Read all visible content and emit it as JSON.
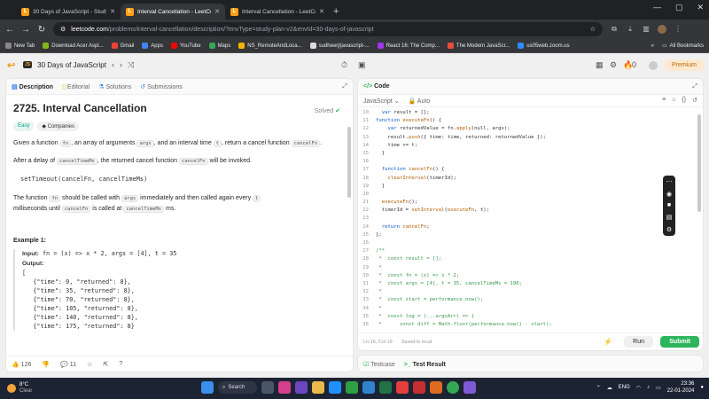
{
  "browser": {
    "tabs": [
      {
        "title": "30 Days of JavaScript - Study P",
        "color": "#ffa116",
        "glyph": "L"
      },
      {
        "title": "Interval Cancellation - LeetCod",
        "color": "#ffa116",
        "glyph": "L"
      },
      {
        "title": "Interval Cancellation - LeetCod",
        "color": "#ffa116",
        "glyph": "L"
      }
    ],
    "new_tab": "+",
    "url_host": "leetcode.com",
    "url_path": "/problems/interval-cancellation/description/?envType=study-plan-v2&envId=30-days-of-javascript",
    "bookmarks": [
      {
        "label": "New Tab",
        "color": "#888"
      },
      {
        "label": "Download Acer Aspi...",
        "color": "#83b81a"
      },
      {
        "label": "Gmail",
        "color": "#ea4335"
      },
      {
        "label": "Apps",
        "color": "#4285f4"
      },
      {
        "label": "YouTube",
        "color": "#ff0000"
      },
      {
        "label": "Maps",
        "color": "#34a853"
      },
      {
        "label": "NS_RemoteAndLoca...",
        "color": "#f4b400"
      },
      {
        "label": "sudheerj/javascript-...",
        "color": "#ddd"
      },
      {
        "label": "React 16: The Comp...",
        "color": "#a435f0"
      },
      {
        "label": "The Modern JavaScr...",
        "color": "#e94e3c"
      },
      {
        "label": "us05web.zoom.us",
        "color": "#2d8cff"
      }
    ],
    "all_bookmarks": "All Bookmarks"
  },
  "leetcode": {
    "badge": "JS",
    "study_title": "30 Days of JavaScript",
    "streak": "0",
    "premium": "Premium"
  },
  "left": {
    "tabs": {
      "description": "Description",
      "editorial": "Editorial",
      "solutions": "Solutions",
      "submissions": "Submissions"
    },
    "title": "2725. Interval Cancellation",
    "solved": "Solved",
    "difficulty": "Easy",
    "companies": "Companies",
    "p1_a": "Given a function ",
    "p1_fn": "fn",
    "p1_b": ", an array of arguments ",
    "p1_args": "args",
    "p1_c": ", and an interval time ",
    "p1_t": "t",
    "p1_d": ", return a cancel function ",
    "p1_cancel": "cancelFn",
    "p1_e": ".",
    "p2_a": "After a delay of ",
    "p2_ms": "cancelTimeMs",
    "p2_b": ", the returned cancel function ",
    "p2_cancel": "cancelFn",
    "p2_c": " will be invoked.",
    "code_example": "setTimeout(cancelFn, cancelTimeMs)",
    "p3_a": "The function ",
    "p3_fn": "fn",
    "p3_b": " should be called with ",
    "p3_args": "args",
    "p3_c": " immediately and then called again every ",
    "p3_t": "t",
    "p3_d": "milliseconds until ",
    "p3_cancel": "cancelFn",
    "p3_e": " is called at ",
    "p3_ms": "cancelTimeMs",
    "p3_f": " ms.",
    "example_title": "Example 1:",
    "input_label": "Input:",
    "input_value": "fn = (x) => x * 2, args = [4], t = 35",
    "output_label": "Output:",
    "output_lines": [
      "[",
      "   {\"time\": 0, \"returned\": 8},",
      "   {\"time\": 35, \"returned\": 8},",
      "   {\"time\": 70, \"returned\": 8},",
      "   {\"time\": 105, \"returned\": 8},",
      "   {\"time\": 140, \"returned\": 8},",
      "   {\"time\": 175, \"returned\": 8}"
    ],
    "likes": "126",
    "comments": "11"
  },
  "right": {
    "code_tab": "Code",
    "language": "JavaScript",
    "auto": "Auto",
    "code_lines": [
      {
        "n": "10",
        "t": "  var result = [];"
      },
      {
        "n": "11",
        "t": "function executeFn() {"
      },
      {
        "n": "12",
        "t": "    var returnedValue = fn.apply(null, args);"
      },
      {
        "n": "13",
        "t": "    result.push({ time: time, returned: returnedValue });"
      },
      {
        "n": "14",
        "t": "    time += t;"
      },
      {
        "n": "15",
        "t": "  }"
      },
      {
        "n": "16",
        "t": ""
      },
      {
        "n": "17",
        "t": "  function cancelFn() {"
      },
      {
        "n": "18",
        "t": "    clearInterval(timerId);"
      },
      {
        "n": "19",
        "t": "  }"
      },
      {
        "n": "20",
        "t": ""
      },
      {
        "n": "21",
        "t": "  executeFn();"
      },
      {
        "n": "22",
        "t": "  timerId = setInterval(executeFn, t);"
      },
      {
        "n": "23",
        "t": ""
      },
      {
        "n": "24",
        "t": "  return cancelFn;"
      },
      {
        "n": "25",
        "t": "};"
      },
      {
        "n": "26",
        "t": ""
      },
      {
        "n": "27",
        "t": "/**"
      },
      {
        "n": "28",
        "t": " *  const result = [];"
      },
      {
        "n": "29",
        "t": " *"
      },
      {
        "n": "30",
        "t": " *  const fn = (x) => x * 2;"
      },
      {
        "n": "31",
        "t": " *  const args = [4], t = 35, cancelTimeMs = 190;"
      },
      {
        "n": "32",
        "t": " *"
      },
      {
        "n": "33",
        "t": " *  const start = performance.now();"
      },
      {
        "n": "34",
        "t": " *"
      },
      {
        "n": "35",
        "t": " *  const log = (...argsArr) => {"
      },
      {
        "n": "36",
        "t": " *      const diff = Math.floor(performance.now() - start);"
      }
    ],
    "cursor_pos": "Ln 16, Col 19",
    "saved": "Saved to local",
    "run": "Run",
    "submit": "Submit",
    "testcase": "Testcase",
    "test_result": "Test Result"
  },
  "taskbar": {
    "temp": "8°C",
    "condition": "Clear",
    "search": "Search",
    "lang": "ENG",
    "time": "23:36",
    "date": "22-01-2024"
  }
}
